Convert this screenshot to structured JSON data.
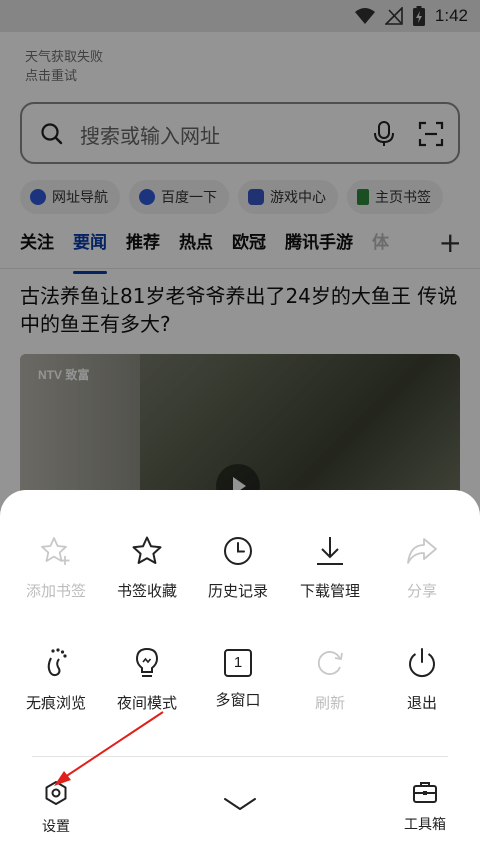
{
  "status_bar": {
    "time": "1:42"
  },
  "weather": {
    "line1": "天气获取失败",
    "line2": "点击重试"
  },
  "search": {
    "placeholder": "搜索或输入网址"
  },
  "chips": [
    {
      "label": "网址导航",
      "color": "#2f5bd8"
    },
    {
      "label": "百度一下",
      "color": "#2f5bd8"
    },
    {
      "label": "游戏中心",
      "color": "#3a56c6"
    },
    {
      "label": "主页书签",
      "color": "#2e8b3a"
    }
  ],
  "tabs": [
    "关注",
    "要闻",
    "推荐",
    "热点",
    "欧冠",
    "腾讯手游",
    "体"
  ],
  "tab_add": "+",
  "news": {
    "headline": "古法养鱼让81岁老爷爷养出了24岁的大鱼王 传说中的鱼王有多大?",
    "video_logo": "NTV 致富"
  },
  "menu": {
    "row1": [
      {
        "label": "添加书签",
        "icon": "star-plus-icon",
        "enabled": false
      },
      {
        "label": "书签收藏",
        "icon": "star-icon",
        "enabled": true
      },
      {
        "label": "历史记录",
        "icon": "clock-icon",
        "enabled": true
      },
      {
        "label": "下载管理",
        "icon": "download-icon",
        "enabled": true
      },
      {
        "label": "分享",
        "icon": "share-icon",
        "enabled": false
      }
    ],
    "row2": [
      {
        "label": "无痕浏览",
        "icon": "footprint-icon",
        "enabled": true
      },
      {
        "label": "夜间模式",
        "icon": "bulb-icon",
        "enabled": true
      },
      {
        "label": "多窗口",
        "icon": "window-count-icon",
        "enabled": true,
        "count": "1"
      },
      {
        "label": "刷新",
        "icon": "refresh-icon",
        "enabled": false
      },
      {
        "label": "退出",
        "icon": "power-icon",
        "enabled": true
      }
    ],
    "settings_label": "设置",
    "toolbox_label": "工具箱"
  },
  "annotation_color": "#e0201b"
}
